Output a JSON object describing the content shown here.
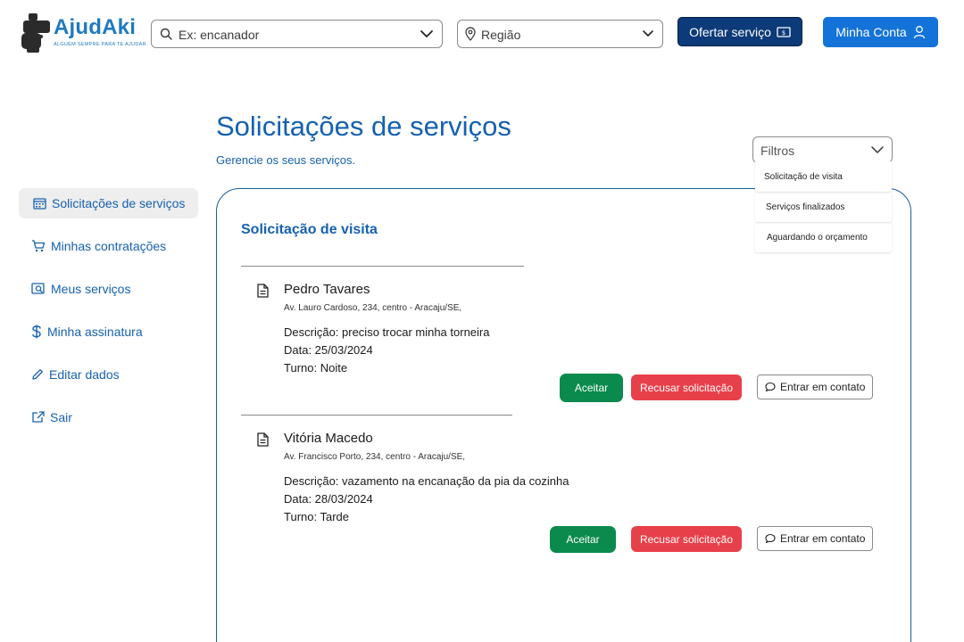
{
  "header": {
    "brand": "AjudAki",
    "tagline": "ALGUÉM SEMPRE PARA TE AJUDAR",
    "search_placeholder": "Ex: encanador",
    "region_label": "Região",
    "offer_button": "Ofertar serviço",
    "account_button": "Minha Conta"
  },
  "page": {
    "title": "Solicitações de serviços",
    "subtitle": "Gerencie os seus serviços."
  },
  "sidebar": {
    "items": [
      {
        "label": "Solicitações de serviços",
        "icon": "calendar-icon",
        "active": true
      },
      {
        "label": "Minhas contratações",
        "icon": "cart-icon"
      },
      {
        "label": "Meus serviços",
        "icon": "search-doc-icon"
      },
      {
        "label": "Minha assinatura",
        "icon": "dollar-icon"
      },
      {
        "label": "Editar dados",
        "icon": "pencil-icon"
      },
      {
        "label": "Sair",
        "icon": "external-link-icon"
      }
    ]
  },
  "filters": {
    "label": "Filtros",
    "options": [
      "Solicitação de visita",
      "Serviços finalizados",
      "Aguardando  o orçamento"
    ]
  },
  "card": {
    "heading": "Solicitação de visita",
    "requests": [
      {
        "name": "Pedro Tavares",
        "address": "Av. Lauro Cardoso, 234, centro - Aracaju/SE,",
        "description": "Descrição: preciso trocar minha torneira",
        "date": "Data: 25/03/2024",
        "shift": "Turno: Noite"
      },
      {
        "name": "Vitória Macedo",
        "address": "Av. Francisco Porto, 234, centro - Aracaju/SE,",
        "description": "Descrição: vazamento na encanação da pia da cozinha",
        "date": "Data: 28/03/2024",
        "shift": "Turno: Tarde"
      }
    ],
    "accept_label": "Aceitar",
    "refuse_label": "Recusar solicitação",
    "contact_label": "Entrar em contato"
  },
  "colors": {
    "primary": "#1661b0",
    "dark_blue": "#0d3a78",
    "accept": "#0a8a4d",
    "refuse": "#e8404a"
  }
}
